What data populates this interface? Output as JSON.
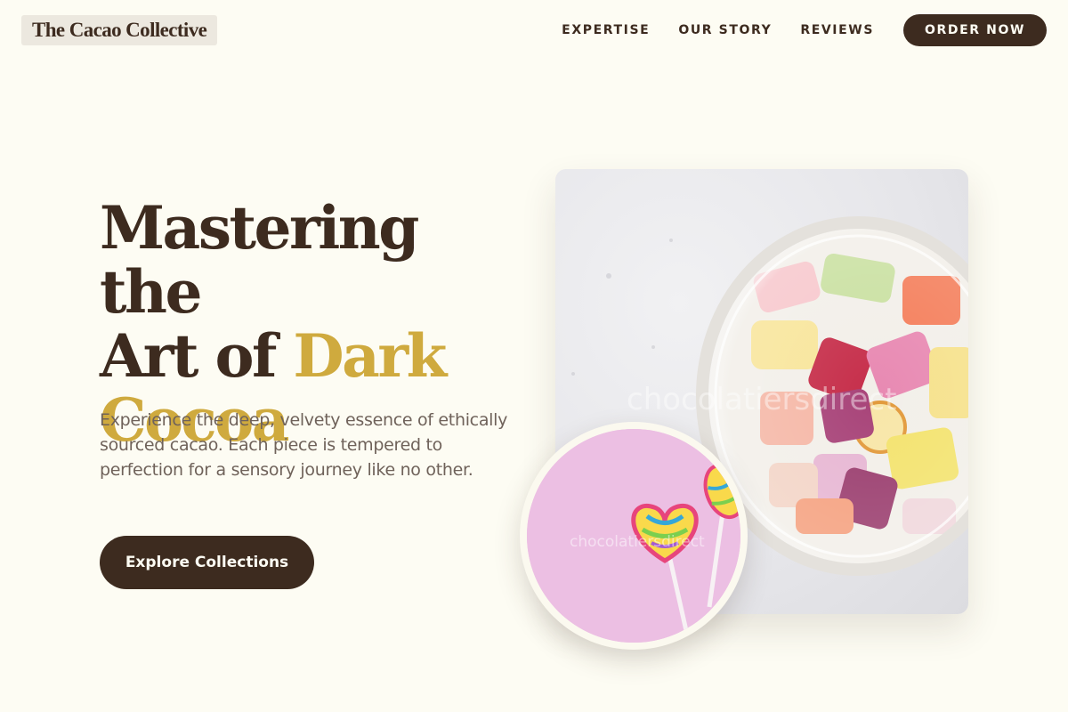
{
  "header": {
    "logo": "The Cacao Collective",
    "nav": [
      "EXPERTISE",
      "OUR STORY",
      "REVIEWS"
    ],
    "order_label": "ORDER NOW"
  },
  "hero": {
    "title_line1": "Mastering the",
    "title_line2_a": "Art of ",
    "title_line2_b": "Dark",
    "title_line3": "Cocoa",
    "description": "Experience the deep, velvety essence of ethically sourced cacao. Each piece is tempered to perfection for a sensory journey like no other.",
    "cta_label": "Explore Collections"
  },
  "images": {
    "main": {
      "subject": "glass jar of assorted colorful hard candies",
      "watermark": "chocolatiersdirect"
    },
    "circle": {
      "subject": "two rainbow swirl lollipops on pink background",
      "watermark": "chocolatiersdirect"
    }
  },
  "colors": {
    "background": "#fdfcf3",
    "primary_dark": "#3d2b1f",
    "accent_gold": "#cfaa3e",
    "body_text": "#6f625a"
  }
}
